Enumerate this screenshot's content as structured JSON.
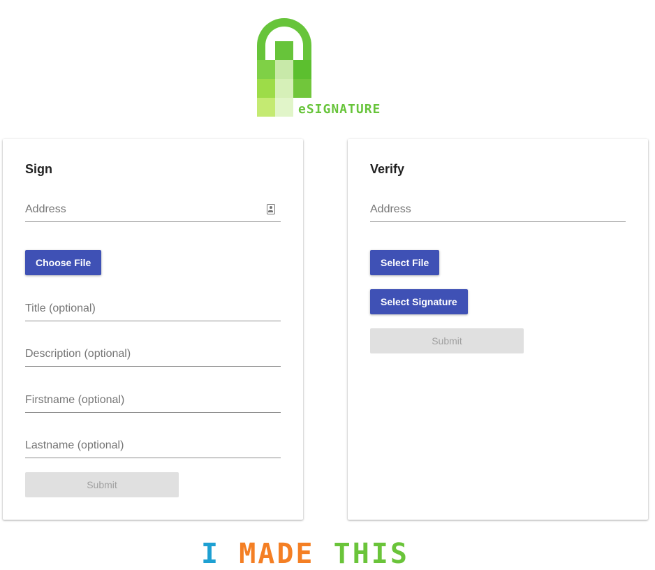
{
  "logo": {
    "wordmark": "eSIGNATURE"
  },
  "sign": {
    "title": "Sign",
    "address_placeholder": "Address",
    "choose_file_label": "Choose File",
    "title_placeholder": "Title (optional)",
    "description_placeholder": "Description (optional)",
    "firstname_placeholder": "Firstname (optional)",
    "lastname_placeholder": "Lastname (optional)",
    "submit_label": "Submit"
  },
  "verify": {
    "title": "Verify",
    "address_placeholder": "Address",
    "select_file_label": "Select File",
    "select_signature_label": "Select Signature",
    "submit_label": "Submit"
  },
  "footer": {
    "word_i": "I",
    "word_made": "MADE",
    "word_this": "THIS"
  },
  "colors": {
    "primary": "#3f51b5",
    "logo_green": "#67c43a",
    "footer_blue": "#1ea0d2",
    "footer_orange": "#f47f24",
    "footer_green": "#6ac43a"
  },
  "icons": {
    "address_field": "contact-card-icon"
  }
}
